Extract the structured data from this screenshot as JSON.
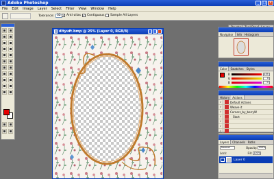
{
  "app": {
    "title": "Adobe Photoshop"
  },
  "menu": [
    "File",
    "Edit",
    "Image",
    "Layer",
    "Select",
    "Filter",
    "View",
    "Window",
    "Help"
  ],
  "options": {
    "tolerance_label": "Tolerance:",
    "tolerance_value": "32",
    "antialias_label": "Anti-alias",
    "contiguous_label": "Contiguous",
    "sample_all_label": "Sample All Layers"
  },
  "palette_well": {
    "tabs": [
      "Brushes",
      "Tool Presets",
      "Layer Comps"
    ]
  },
  "document": {
    "title": "dltyuft.bmp @ 25% (Layer 0, RGB/8)"
  },
  "navigator": {
    "tabs": [
      "Navigator",
      "Info",
      "Histogram"
    ]
  },
  "color_panel": {
    "tabs": [
      "Color",
      "Swatches",
      "Styles"
    ],
    "channels": [
      {
        "label": "R",
        "value": "235"
      },
      {
        "label": "G",
        "value": "0"
      },
      {
        "label": "B",
        "value": "0"
      }
    ]
  },
  "actions": {
    "tabs": [
      "History",
      "Actions"
    ],
    "items": [
      "Default Actions",
      "Weave it",
      "Corners_by_berryW",
      "Start",
      "",
      "",
      ""
    ]
  },
  "layers": {
    "tabs": [
      "Layers",
      "Channels",
      "Paths"
    ],
    "blend_mode": "Normal",
    "opacity_label": "Opacity:",
    "opacity_value": "100%",
    "lock_label": "Lock:",
    "fill_label": "Fill:",
    "fill_value": "100%",
    "layer_name": "Layer 0"
  },
  "colors": {
    "accent": "#0a3db5",
    "foreground": "#e50000",
    "background": "#ffffff"
  }
}
